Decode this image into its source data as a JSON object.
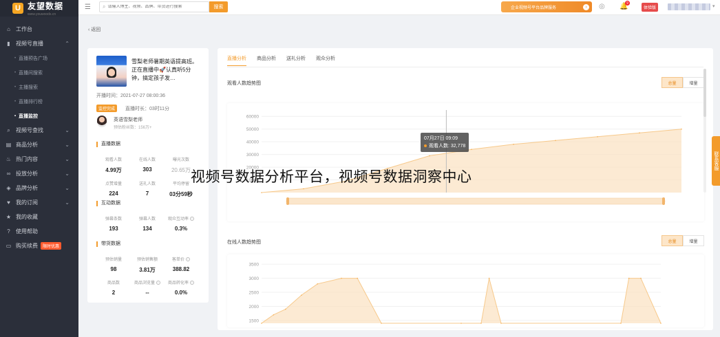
{
  "brand": {
    "name": "友望数据",
    "sub": "www.youwoods.cn"
  },
  "header": {
    "search_placeholder": "请输入博主、视频、品牌、带货进行搜索",
    "search_btn": "搜索",
    "promo": "企业视频号平台品牌服务",
    "notif_count": "9",
    "edition": "体验版"
  },
  "sidebar": {
    "items": [
      {
        "label": "工作台",
        "icon": "home-icon"
      },
      {
        "label": "视频号直播",
        "icon": "chart-icon"
      },
      {
        "label": "视频号查找",
        "icon": "search-icon"
      },
      {
        "label": "商品分析",
        "icon": "cart-icon"
      },
      {
        "label": "热门内容",
        "icon": "fire-icon"
      },
      {
        "label": "投放分析",
        "icon": "link-icon"
      },
      {
        "label": "品牌分析",
        "icon": "tag-icon"
      },
      {
        "label": "我的订阅",
        "icon": "heart-icon"
      },
      {
        "label": "我的收藏",
        "icon": "star-icon"
      },
      {
        "label": "使用帮助",
        "icon": "help-icon"
      },
      {
        "label": "购买续费",
        "icon": "card-icon",
        "badge": "限时优惠"
      }
    ],
    "sub_items": [
      "直播预告广场",
      "直播间搜索",
      "主播搜索",
      "直播排行榜",
      "直播监控"
    ]
  },
  "back_label": "返回",
  "live": {
    "title": "雪梨老师暑期英语提高班。正在直播中🚀认真听5分钟，搞定孩子发…",
    "start_time": "开播时间：2021-07-27 08:00:36",
    "status": "监控完成",
    "duration": "直播时长：03时11分",
    "anchor_name": "英语雪梨老师",
    "anchor_stat": "预估粉丝数：156万+"
  },
  "sections": {
    "live_data": "直播数据",
    "interact": "互动数据",
    "sales": "带货数据"
  },
  "stats_live": [
    {
      "label": "观看人数",
      "value": "4.99万"
    },
    {
      "label": "在线人数",
      "value": "303"
    },
    {
      "label": "曝光次数",
      "value": "20.65万"
    },
    {
      "label": "点赞增量",
      "value": "224"
    },
    {
      "label": "送礼人数",
      "value": "7"
    },
    {
      "label": "平均停留",
      "value": "03分59秒"
    }
  ],
  "stats_interact": [
    {
      "label": "弹幕条数",
      "value": "193"
    },
    {
      "label": "弹幕人数",
      "value": "134"
    },
    {
      "label": "观众互动率",
      "value": "0.3%"
    }
  ],
  "stats_sales": [
    {
      "label": "预估销量",
      "value": "98"
    },
    {
      "label": "预估销售额",
      "value": "3.81万"
    },
    {
      "label": "客单价",
      "value": "388.82"
    },
    {
      "label": "商品数",
      "value": "2"
    },
    {
      "label": "商品浏览量",
      "value": "--"
    },
    {
      "label": "商品转化率",
      "value": "0.0%"
    }
  ],
  "tabs": [
    "直播分析",
    "商品分析",
    "送礼分析",
    "观众分析"
  ],
  "charts": {
    "viewers_title": "观看人数趋势图",
    "online_title": "在线人数趋势图",
    "seg_total": "总量",
    "seg_incr": "增量"
  },
  "tooltip": {
    "time": "07月27日 09:09",
    "label": "观看人数: 32,778"
  },
  "watermark": "视频号数据分析平台，视频号数据洞察中心",
  "side_float": "联系客服",
  "chart_data": [
    {
      "type": "area",
      "title": "观看人数趋势图",
      "y_ticks": [
        10000,
        20000,
        30000,
        40000,
        50000,
        60000
      ],
      "ylim": [
        0,
        65000
      ],
      "x": [
        0,
        0.1,
        0.2,
        0.3,
        0.4,
        0.5,
        0.6,
        0.7,
        0.8,
        0.9,
        1.0
      ],
      "values": [
        0,
        3000,
        9000,
        19000,
        29000,
        34000,
        38000,
        41000,
        44000,
        47000,
        50000
      ]
    },
    {
      "type": "area",
      "title": "在线人数趋势图",
      "y_ticks": [
        1500,
        2000,
        2500,
        3000,
        3500
      ],
      "ylim": [
        1400,
        3700
      ],
      "x": [
        0,
        0.03,
        0.06,
        0.1,
        0.14,
        0.2,
        0.24,
        0.3,
        0.5,
        0.55,
        0.57,
        0.6,
        0.9,
        0.92,
        0.95,
        1.0
      ],
      "values": [
        1400,
        1700,
        1900,
        2400,
        2800,
        3000,
        3000,
        1400,
        1400,
        1400,
        3000,
        1400,
        1400,
        3000,
        3000,
        1400
      ]
    }
  ]
}
